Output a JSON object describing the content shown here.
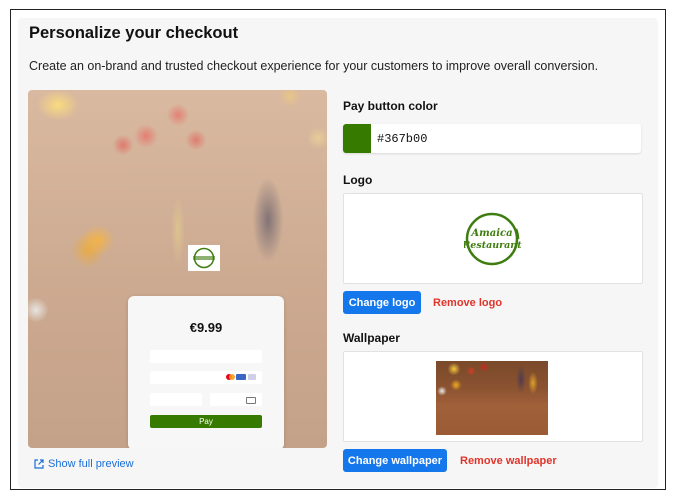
{
  "header": {
    "title": "Personalize your checkout",
    "subtitle": "Create an on-brand and trusted checkout experience for your customers to improve overall conversion."
  },
  "preview": {
    "price": "€9.99",
    "pay_label": "Pay",
    "full_preview_link": "Show full preview"
  },
  "pay_button_color": {
    "label": "Pay button color",
    "value": "#367b00",
    "swatch_color": "#367b00"
  },
  "logo": {
    "label": "Logo",
    "line1": "Amaica",
    "line2": "Restaurant",
    "change_label": "Change logo",
    "remove_label": "Remove logo"
  },
  "wallpaper": {
    "label": "Wallpaper",
    "change_label": "Change wallpaper",
    "remove_label": "Remove wallpaper"
  },
  "colors": {
    "primary": "#1577ec",
    "danger": "#e0342b",
    "brand_green": "#367b00",
    "link": "#1a6fd6"
  }
}
